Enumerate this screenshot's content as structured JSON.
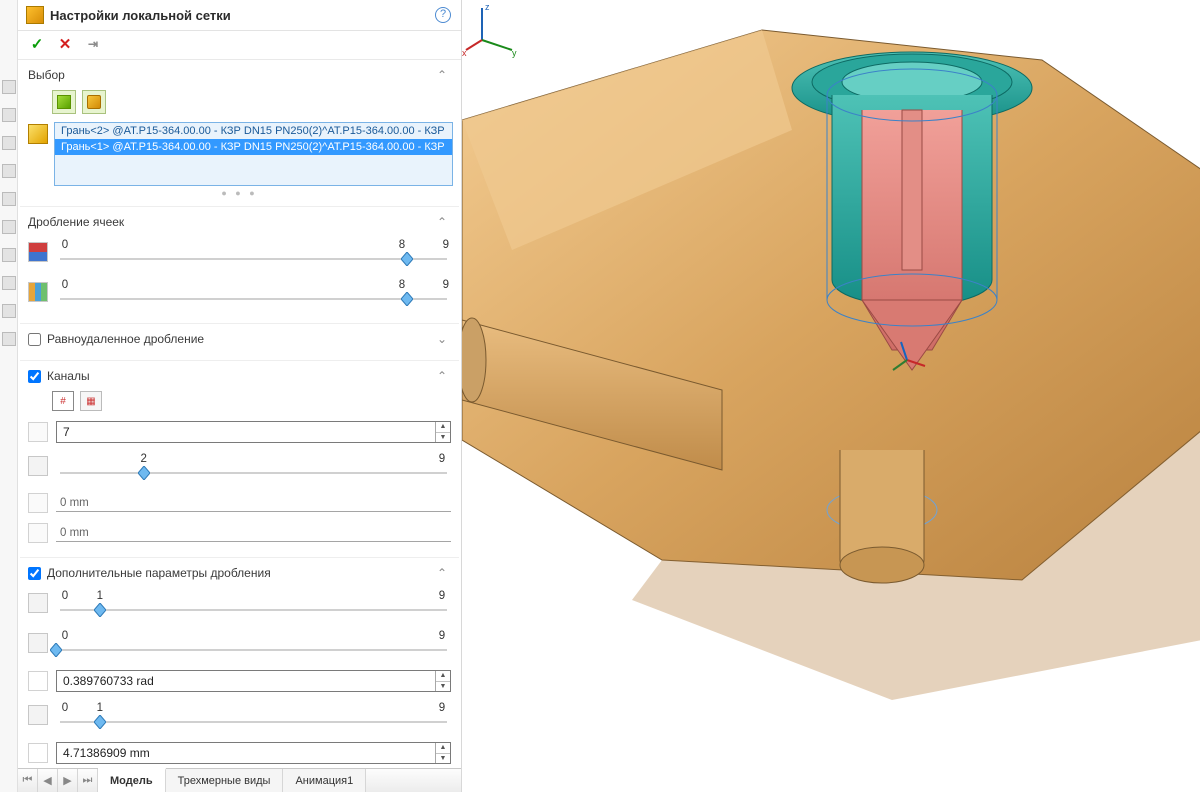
{
  "header": {
    "title": "Настройки локальной сетки",
    "help": "?"
  },
  "actions": {
    "ok": "✓",
    "cancel": "✕",
    "pin": "⇥"
  },
  "sections": {
    "selection": {
      "title": "Выбор",
      "items": [
        "Грань<2> @AT.P15-364.00.00 - КЗР DN15 PN250(2)^AT.P15-364.00.00 - КЗР",
        "Грань<1> @AT.P15-364.00.00 - КЗР DN15 PN250(2)^AT.P15-364.00.00 - КЗР"
      ]
    },
    "refine": {
      "title": "Дробление ячеек",
      "sliders": [
        {
          "min": "0",
          "cur": "8",
          "max": "9",
          "cur_pct": 88.8
        },
        {
          "min": "0",
          "cur": "8",
          "max": "9",
          "cur_pct": 88.8
        }
      ]
    },
    "equidist": {
      "title": "Равноудаленное дробление",
      "checked": false
    },
    "channels": {
      "title": "Каналы",
      "checked": true,
      "num_value": "7",
      "slider": {
        "min": "",
        "cur": "2",
        "max": "9",
        "cur_pct": 22.2
      },
      "val_a": "0 mm",
      "val_b": "0 mm"
    },
    "extra": {
      "title": "Дополнительные параметры дробления",
      "checked": true,
      "s1": {
        "min": "0",
        "cur": "1",
        "max": "9",
        "cur_pct": 11.1
      },
      "s2": {
        "min": "0",
        "cur": "",
        "max": "9",
        "cur_pct": 0
      },
      "angle": "0.389760733 rad",
      "s3": {
        "min": "0",
        "cur": "1",
        "max": "9",
        "cur_pct": 11.1
      },
      "len": "4.71386909 mm"
    }
  },
  "tabs": {
    "nav": [
      "⏮",
      "◀",
      "▶",
      "⏭"
    ],
    "items": [
      "Модель",
      "Трехмерные виды",
      "Анимация1"
    ],
    "active": 0
  },
  "triad": {
    "x": "x",
    "y": "y",
    "z": "z"
  }
}
